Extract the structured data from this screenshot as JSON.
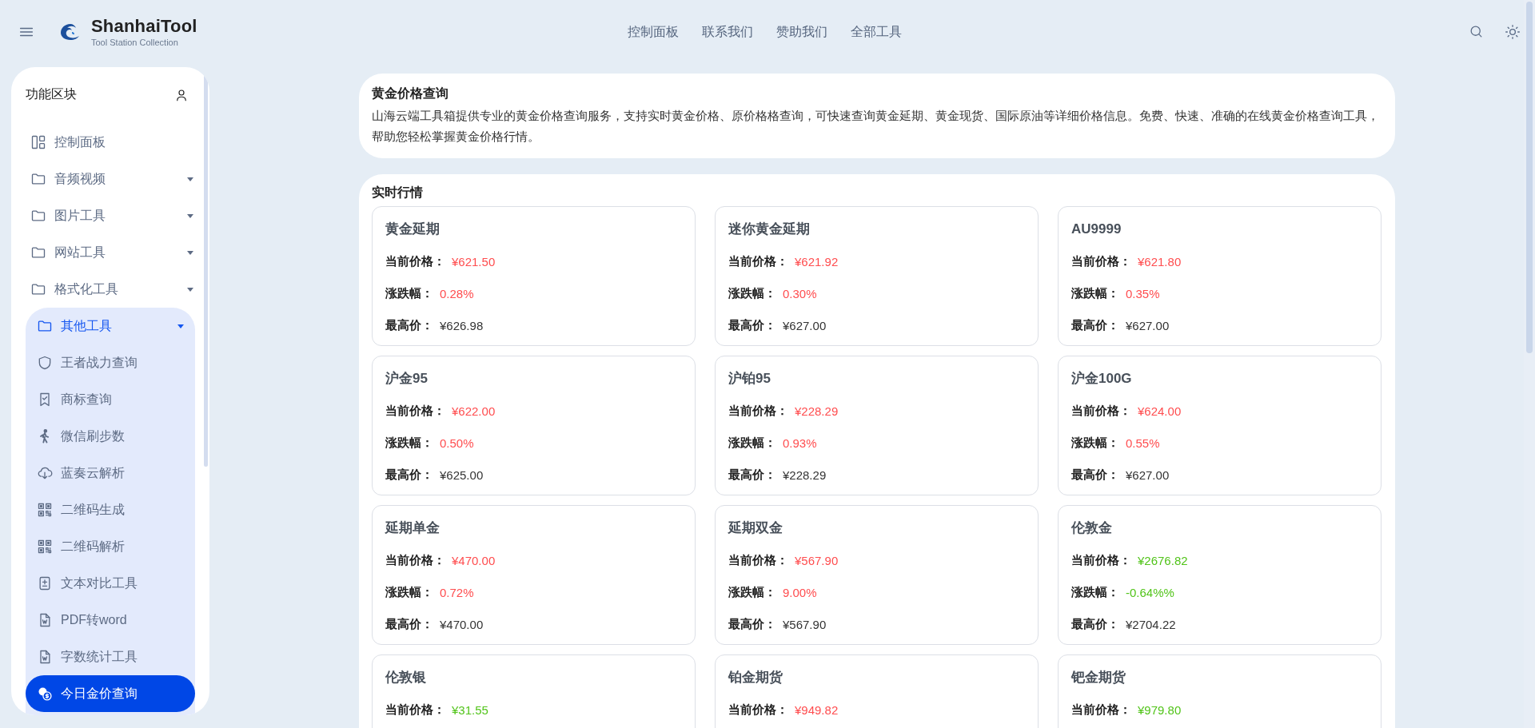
{
  "header": {
    "brand_light": "Shanhai",
    "brand_bold": "Tool",
    "tagline": "Tool Station Collection",
    "nav": [
      {
        "label": "控制面板"
      },
      {
        "label": "联系我们"
      },
      {
        "label": "赞助我们"
      },
      {
        "label": "全部工具"
      }
    ]
  },
  "sidebar": {
    "title": "功能区块",
    "items": [
      {
        "label": "控制面板",
        "kind": "link",
        "selected": false
      },
      {
        "label": "音频视频",
        "kind": "group",
        "expanded": false,
        "selected": false
      },
      {
        "label": "图片工具",
        "kind": "group",
        "expanded": false,
        "selected": false
      },
      {
        "label": "网站工具",
        "kind": "group",
        "expanded": false,
        "selected": false
      },
      {
        "label": "格式化工具",
        "kind": "group",
        "expanded": false,
        "selected": false
      },
      {
        "label": "其他工具",
        "kind": "group",
        "expanded": true,
        "selected": false,
        "children": [
          {
            "label": "王者战力查询",
            "selected": false
          },
          {
            "label": "商标查询",
            "selected": false
          },
          {
            "label": "微信刷步数",
            "selected": false
          },
          {
            "label": "蓝奏云解析",
            "selected": false
          },
          {
            "label": "二维码生成",
            "selected": false
          },
          {
            "label": "二维码解析",
            "selected": false
          },
          {
            "label": "文本对比工具",
            "selected": false
          },
          {
            "label": "PDF转word",
            "selected": false
          },
          {
            "label": "字数统计工具",
            "selected": false
          },
          {
            "label": "今日金价查询",
            "selected": true
          }
        ]
      }
    ]
  },
  "intro": {
    "title": "黄金价格查询",
    "text": "山海云端工具箱提供专业的黄金价格查询服务，支持实时黄金价格、原价格格查询，可快速查询黄金延期、黄金现货、国际原油等详细价格信息。免费、快速、准确的在线黄金价格查询工具，帮助您轻松掌握黄金价格行情。"
  },
  "market": {
    "title": "实时行情",
    "cards": [
      {
        "name": "黄金延期",
        "color": "#ff4d4f",
        "price_label": "当前价格：",
        "price": "¥621.50",
        "change_label": "涨跌幅：",
        "change": "0.28%",
        "high_label": "最高价：",
        "high": "¥626.98"
      },
      {
        "name": "迷你黄金延期",
        "color": "#ff4d4f",
        "price_label": "当前价格：",
        "price": "¥621.92",
        "change_label": "涨跌幅：",
        "change": "0.30%",
        "high_label": "最高价：",
        "high": "¥627.00"
      },
      {
        "name": "AU9999",
        "color": "#ff4d4f",
        "price_label": "当前价格：",
        "price": "¥621.80",
        "change_label": "涨跌幅：",
        "change": "0.35%",
        "high_label": "最高价：",
        "high": "¥627.00"
      },
      {
        "name": "沪金95",
        "color": "#ff4d4f",
        "price_label": "当前价格：",
        "price": "¥622.00",
        "change_label": "涨跌幅：",
        "change": "0.50%",
        "high_label": "最高价：",
        "high": "¥625.00"
      },
      {
        "name": "沪铂95",
        "color": "#ff4d4f",
        "price_label": "当前价格：",
        "price": "¥228.29",
        "change_label": "涨跌幅：",
        "change": "0.93%",
        "high_label": "最高价：",
        "high": "¥228.29"
      },
      {
        "name": "沪金100G",
        "color": "#ff4d4f",
        "price_label": "当前价格：",
        "price": "¥624.00",
        "change_label": "涨跌幅：",
        "change": "0.55%",
        "high_label": "最高价：",
        "high": "¥627.00"
      },
      {
        "name": "延期单金",
        "color": "#ff4d4f",
        "price_label": "当前价格：",
        "price": "¥470.00",
        "change_label": "涨跌幅：",
        "change": "0.72%",
        "high_label": "最高价：",
        "high": "¥470.00"
      },
      {
        "name": "延期双金",
        "color": "#ff4d4f",
        "price_label": "当前价格：",
        "price": "¥567.90",
        "change_label": "涨跌幅：",
        "change": "9.00%",
        "high_label": "最高价：",
        "high": "¥567.90"
      },
      {
        "name": "伦敦金",
        "color": "#52c41a",
        "price_label": "当前价格：",
        "price": "¥2676.82",
        "change_label": "涨跌幅：",
        "change": "-0.64%%",
        "high_label": "最高价：",
        "high": "¥2704.22"
      },
      {
        "name": "伦敦银",
        "color": "#52c41a",
        "price_label": "当前价格：",
        "price": "¥31.55"
      },
      {
        "name": "铂金期货",
        "color": "#ff4d4f",
        "price_label": "当前价格：",
        "price": "¥949.82"
      },
      {
        "name": "钯金期货",
        "color": "#52c41a",
        "price_label": "当前价格：",
        "price": "¥979.80"
      }
    ]
  }
}
